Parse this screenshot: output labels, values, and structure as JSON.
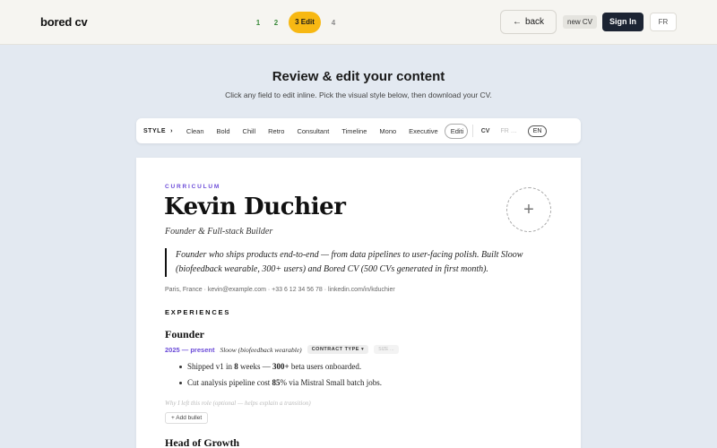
{
  "header": {
    "logo": "bored cv",
    "steps": [
      "1",
      "2",
      "3 Edit",
      "4"
    ],
    "back_arrow": "←",
    "back_label": "back",
    "new_cv": "new CV",
    "sign_in": "Sign In",
    "lang": "FR"
  },
  "intro": {
    "title": "Review & edit your content",
    "subtitle": "Click any field to edit inline. Pick the visual style below, then download your CV."
  },
  "stylebar": {
    "label": "STYLE",
    "chevron": "›",
    "options": [
      "Clean",
      "Bold",
      "Chill",
      "Retro",
      "Consultant",
      "Timeline",
      "Mono",
      "Executive"
    ],
    "selected": "Editi",
    "cv_label": "CV",
    "fr_label": "FR …",
    "en_label": "EN"
  },
  "cv": {
    "kicker": "CURRICULUM",
    "name": "Kevin Duchier",
    "role": "Founder & Full-stack Builder",
    "avatar_plus": "+",
    "summary": "Founder who ships products end-to-end — from data pipelines to user-facing polish. Built Sloow (biofeedback wearable, 300+ users) and Bored CV (500 CVs generated in first month).",
    "contact": "Paris, France · kevin@example.com · +33 6 12 34 56 78 · linkedin.com/in/kduchier",
    "section_experiences": "EXPERIENCES",
    "jobs": [
      {
        "title": "Founder",
        "dates": "2025 — present",
        "company": "Sloow (biofeedback wearable)",
        "contract": "CONTRACT TYPE",
        "contract_caret": "▾",
        "size": "SIZE  …",
        "bullets": [
          {
            "pre": "Shipped v1 in ",
            "b1": "8",
            "mid": " weeks — ",
            "b2": "300+",
            "post": " beta users onboarded."
          },
          {
            "pre": "Cut analysis pipeline cost ",
            "b1": "85",
            "mid": "% via Mistral Small batch jobs.",
            "b2": "",
            "post": ""
          }
        ],
        "why_placeholder": "Why I left this role (optional — helps explain a transition)",
        "add_bullet": "+ Add bullet"
      },
      {
        "title": "Head of Growth"
      }
    ]
  }
}
